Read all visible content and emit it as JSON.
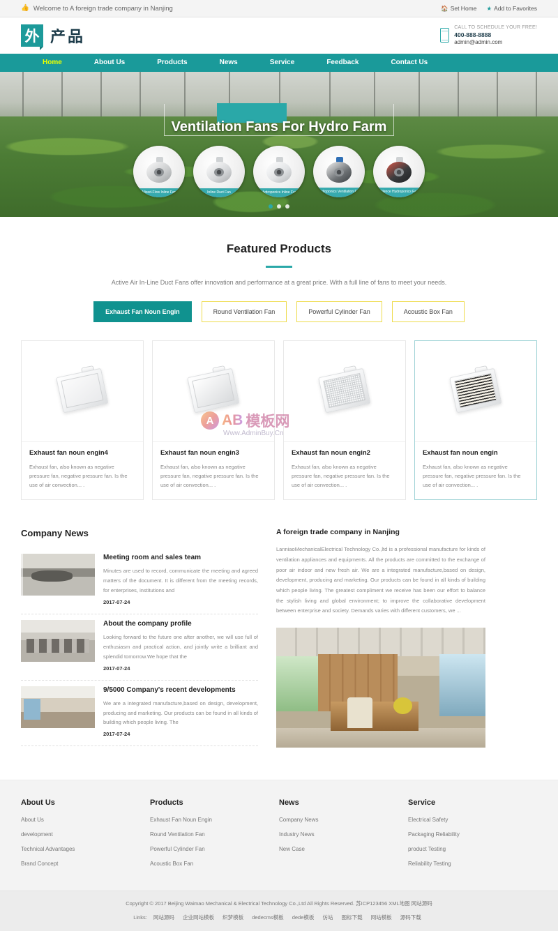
{
  "topbar": {
    "thumb_icon": "thumbs-up-icon",
    "welcome": "Welcome to A foreign trade company in Nanjing",
    "set_home_icon": "home-icon",
    "set_home": "Set Home",
    "favorites_icon": "star-icon",
    "favorites": "Add to Favorites"
  },
  "header": {
    "logo_badge": "外",
    "logo_text": "产品",
    "phone_icon": "mobile-phone-icon",
    "call_line": "CALL TO SCHEDULE YOUR FREE!",
    "phone": "400-888-8888",
    "email": "admin@admin.com"
  },
  "nav": {
    "items": [
      {
        "label": "Home",
        "active": true
      },
      {
        "label": "About Us",
        "active": false
      },
      {
        "label": "Products",
        "active": false
      },
      {
        "label": "News",
        "active": false
      },
      {
        "label": "Service",
        "active": false
      },
      {
        "label": "Feedback",
        "active": false
      },
      {
        "label": "Contact Us",
        "active": false
      }
    ]
  },
  "hero": {
    "title": "Ventilation Fans For Hydro Farm",
    "fans": [
      {
        "label": "Mixed-Flow Inline Fan"
      },
      {
        "label": "Inline Duct Fan"
      },
      {
        "label": "Hydroponics Inline Fan"
      },
      {
        "label": "Hydroponics Ventilation Fan"
      },
      {
        "label": "Silence Hydroponics Fan"
      }
    ],
    "dots": 3,
    "active_dot": 1
  },
  "featured": {
    "title": "Featured Products",
    "subtitle": "Active Air In-Line Duct Fans offer innovation and performance at a great price. With a full line of fans to meet your needs.",
    "tabs": [
      {
        "label": "Exhaust Fan Noun Engin",
        "active": true
      },
      {
        "label": "Round Ventilation Fan",
        "active": false
      },
      {
        "label": "Powerful Cylinder Fan",
        "active": false
      },
      {
        "label": "Acoustic Box Fan",
        "active": false
      }
    ],
    "products": [
      {
        "title": "Exhaust fan noun engin4",
        "desc": "Exhaust fan, also known as negative pressure fan, negative pressure fan. Is the use of air convection... ."
      },
      {
        "title": "Exhaust fan noun engin3",
        "desc": "Exhaust fan, also known as negative pressure fan, negative pressure fan. Is the use of air convection... ."
      },
      {
        "title": "Exhaust fan noun engin2",
        "desc": "Exhaust fan, also known as negative pressure fan, negative pressure fan. Is the use of air convection... ."
      },
      {
        "title": "Exhaust fan noun engin",
        "desc": "Exhaust fan, also known as negative pressure fan, negative pressure fan. Is the use of air convection... ."
      }
    ]
  },
  "watermark": {
    "letter": "A",
    "ab": "AB",
    "cn": "模板网",
    "site": "Www.AdminBuy.Cn"
  },
  "news": {
    "title": "Company News",
    "items": [
      {
        "title": "Meeting room and sales team",
        "desc": "Minutes are used to record, communicate the meeting and agreed matters of the document. It is different from the meeting records, for enterprises, institutions and",
        "date": "2017-07-24"
      },
      {
        "title": "About the company profile",
        "desc": "Looking forward to the future one after another, we will use full of enthusiasm and practical action, and jointly write a brilliant and splendid tomorrow.We hope that the",
        "date": "2017-07-24"
      },
      {
        "title": "9/5000 Company's recent developments",
        "desc": "We are a integrated manufacture,based on design, development, producing and marketing. Our products can be found in all kinds of building which people living. The",
        "date": "2017-07-24"
      }
    ]
  },
  "about": {
    "title": "A foreign trade company in Nanjing",
    "paragraph": "LanniaoMechanicalElectrical Technology Co.,ltd is a professional manufacture for kinds of ventilation appliances and equipments. All the products are committed to the exchange of poor air indoor and new fresh air. We are a integrated manufacture,based on design, development, producing and marketing. Our products can be found in all kinds of building which people living. The greatest compliment we receive has been our effort to balance the stylish living and global environment; to improve the collaborative development between enterprise and society. Demands varies with different customers, we ..."
  },
  "footer": {
    "columns": [
      {
        "title": "About Us",
        "links": [
          "About Us",
          "development",
          "Technical Advantages",
          "Brand Concept"
        ]
      },
      {
        "title": "Products",
        "links": [
          "Exhaust Fan Noun Engin",
          "Round Ventilation Fan",
          "Powerful Cylinder Fan",
          "Acoustic Box Fan"
        ]
      },
      {
        "title": "News",
        "links": [
          "Company News",
          "Industry News",
          "New Case"
        ]
      },
      {
        "title": "Service",
        "links": [
          "Electrical Safety",
          "Packaging Reliability",
          "product Testing",
          "Reliability Testing"
        ]
      }
    ],
    "copyright": "Copyright © 2017 Beijing Waimao Mechanical & Electrical Technology Co.,Ltd All Rights Reserved.",
    "icp": "苏ICP123456",
    "xml_map": "XML地图",
    "source": "网站源码",
    "links_label": "Links:",
    "links": [
      "网站源码",
      "企业网站模板",
      "织梦模板",
      "dedecms模板",
      "dede模板",
      "仿站",
      "图标下载",
      "网站模板",
      "源码下载"
    ]
  },
  "colors": {
    "teal": "#1a9a9a",
    "teal_dark": "#10928f",
    "accent_yellow": "#eedb4a",
    "nav_active": "#eaff00"
  }
}
